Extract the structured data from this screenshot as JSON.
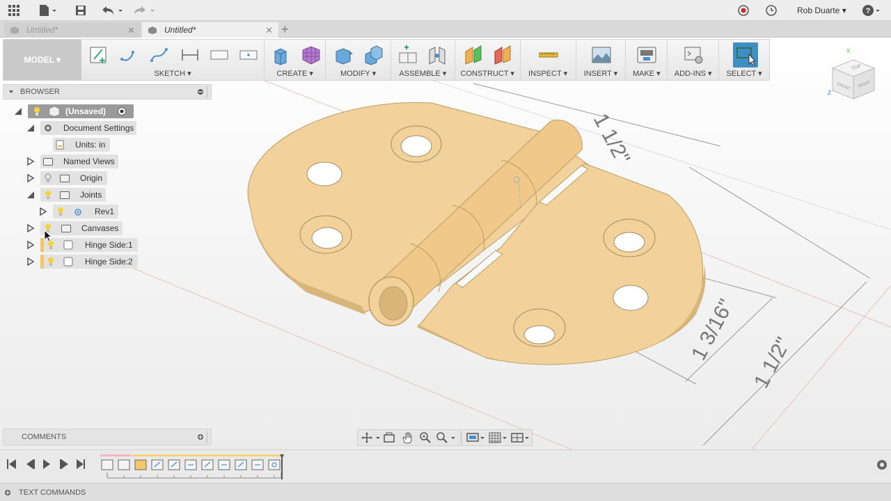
{
  "app_bar": {
    "user_name": "Rob Duarte",
    "icons": [
      "grid-menu-icon",
      "file-icon",
      "save-icon",
      "undo-icon",
      "redo-icon",
      "record-icon",
      "clock-icon",
      "help-icon"
    ]
  },
  "tabs": [
    {
      "label": "Untitled*",
      "active": false
    },
    {
      "label": "Untitled*",
      "active": true
    }
  ],
  "ribbon": {
    "workspace": "MODEL ▾",
    "groups": [
      {
        "label": "SKETCH ▾"
      },
      {
        "label": "CREATE ▾"
      },
      {
        "label": "MODIFY ▾"
      },
      {
        "label": "ASSEMBLE ▾"
      },
      {
        "label": "CONSTRUCT ▾"
      },
      {
        "label": "INSPECT ▾"
      },
      {
        "label": "INSERT ▾"
      },
      {
        "label": "MAKE ▾"
      },
      {
        "label": "ADD-INS ▾"
      },
      {
        "label": "SELECT ▾"
      }
    ]
  },
  "browser": {
    "title": "BROWSER",
    "items": [
      {
        "label": "(Unsaved)"
      },
      {
        "label": "Document Settings"
      },
      {
        "label": "Units: in"
      },
      {
        "label": "Named Views"
      },
      {
        "label": "Origin"
      },
      {
        "label": "Joints"
      },
      {
        "label": "Rev1"
      },
      {
        "label": "Canvases"
      },
      {
        "label": "Hinge Side:1"
      },
      {
        "label": "Hinge Side:2"
      }
    ]
  },
  "comments": {
    "title": "COMMENTS"
  },
  "text_commands": {
    "title": "TEXT COMMANDS"
  },
  "viewcube": {
    "top": "TOP",
    "front": "FRONT",
    "right": "RIGHT",
    "axis_x": "X",
    "axis_z": "Z"
  },
  "dimensions": {
    "dim_a": "1 1/2\"",
    "dim_b": "1 3/16\"",
    "dim_c": "1 1/2\""
  },
  "colors": {
    "hinge": "#f2d29a",
    "select_accent": "#3f8fc4",
    "active_highlight": "#f7c36a"
  }
}
